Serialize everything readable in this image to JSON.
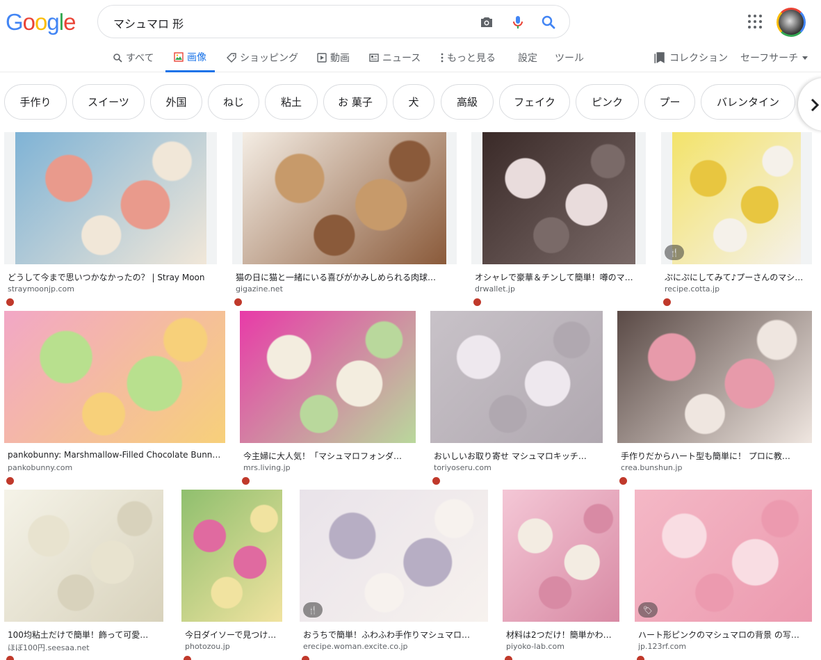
{
  "logo": {
    "letters": [
      "G",
      "o",
      "o",
      "g",
      "l",
      "e"
    ],
    "colors": [
      "#4285f4",
      "#ea4335",
      "#fbbc05",
      "#4285f4",
      "#34a853",
      "#ea4335"
    ]
  },
  "search": {
    "query": "マシュマロ 形",
    "icons": [
      "camera-icon",
      "microphone-icon",
      "search-icon"
    ]
  },
  "header": {
    "apps_icon": "apps-grid-icon",
    "avatar": "account-avatar"
  },
  "tabs": [
    {
      "label": "すべて",
      "icon": "search-icon"
    },
    {
      "label": "画像",
      "icon": "image-icon",
      "active": true
    },
    {
      "label": "ショッピング",
      "icon": "tag-icon"
    },
    {
      "label": "動画",
      "icon": "play-icon"
    },
    {
      "label": "ニュース",
      "icon": "news-icon"
    },
    {
      "label": "もっと見る",
      "icon": "more-vert-icon"
    },
    {
      "label": "設定"
    },
    {
      "label": "ツール"
    }
  ],
  "tabs_right": {
    "collections": "コレクション",
    "safesearch": "セーフサーチ"
  },
  "chips": [
    "手作り",
    "スイーツ",
    "外国",
    "ねじ",
    "粘土",
    "お 菓子",
    "犬",
    "高級",
    "フェイク",
    "ピンク",
    "プー",
    "バレンタイン"
  ],
  "results": [
    {
      "title": "どうして今まで思いつかなかったの？ | Stray Moon",
      "source": "straymoonjp.com",
      "colors": [
        "#7fb3d6",
        "#e99a8c",
        "#f1e7d8"
      ]
    },
    {
      "title": "猫の日に猫と一緒にいる喜びがかみしめられる肉球…",
      "source": "gigazine.net",
      "colors": [
        "#f4ede4",
        "#c79a6a",
        "#8a5a3a"
      ]
    },
    {
      "title": "オシャレで豪華＆チンして簡単！噂のマ…",
      "source": "drwallet.jp",
      "colors": [
        "#3a2a28",
        "#e9dcdc",
        "#7a6a68"
      ]
    },
    {
      "title": "ぷにぷにしてみて♪プーさんのマシ…",
      "source": "recipe.cotta.jp",
      "colors": [
        "#f3e36a",
        "#e8c640",
        "#f5f1ea"
      ],
      "badge": "🍴"
    },
    {
      "title": "pankobunny: Marshmallow-Filled Chocolate Bunnie…",
      "source": "pankobunny.com",
      "colors": [
        "#f2a7c6",
        "#b8e08e",
        "#f7d07a"
      ]
    },
    {
      "title": "今主婦に大人気！「マシュマロフォンダ…",
      "source": "mrs.living.jp",
      "colors": [
        "#e83aa8",
        "#f3eddf",
        "#b9d89c"
      ]
    },
    {
      "title": "おいしいお取り寄せ マシュマロキッチ…",
      "source": "toriyoseru.com",
      "colors": [
        "#c8c2c8",
        "#eee8ee",
        "#b0a8b0"
      ]
    },
    {
      "title": "手作りだからハート型も簡単に！ プロに教…",
      "source": "crea.bunshun.jp",
      "colors": [
        "#5a4a46",
        "#e79aaa",
        "#efe6e0"
      ]
    },
    {
      "title": "100均粘土だけで簡単！飾って可愛…",
      "source": "ほぼ100円.seesaa.net",
      "colors": [
        "#f5f3e8",
        "#e8e3cf",
        "#d8d2bc"
      ]
    },
    {
      "title": "今日ダイソーで見つけ…",
      "source": "photozou.jp",
      "colors": [
        "#8fbf6e",
        "#e06aa0",
        "#f1e3a0"
      ]
    },
    {
      "title": "おうちで簡単！ふわふわ手作りマシュマロ…",
      "source": "erecipe.woman.excite.co.jp",
      "colors": [
        "#e9e3ea",
        "#b7aec4",
        "#f7f2ee"
      ],
      "badge": "🍴"
    },
    {
      "title": "材料は2つだけ！簡単かわ…",
      "source": "piyoko-lab.com",
      "colors": [
        "#f4c7d6",
        "#f3ece2",
        "#d88aa4"
      ]
    },
    {
      "title": "ハート形ピンクのマシュマロの背景 の写…",
      "source": "jp.123rf.com",
      "colors": [
        "#f4b8c6",
        "#f9dde3",
        "#ec9aaf"
      ],
      "badge": "🏷"
    }
  ]
}
